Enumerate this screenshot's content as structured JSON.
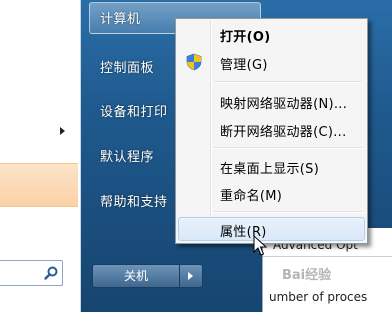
{
  "right_pane": {
    "computer": "计算机",
    "control_panel": "控制面板",
    "devices": "设备和打印",
    "default_programs": "默认程序",
    "help": "帮助和支持",
    "shutdown": "关机"
  },
  "context_menu": {
    "items": [
      {
        "label": "打开(O)"
      },
      {
        "label": "管理(G)"
      },
      {
        "label": "映射网络驱动器(N)..."
      },
      {
        "label": "断开网络驱动器(C)..."
      },
      {
        "label": "在桌面上显示(S)"
      },
      {
        "label": "重命名(M)"
      },
      {
        "label": "属性(R)"
      }
    ]
  },
  "background_window": {
    "title": "Advanced Opt",
    "text": "umber of proces"
  },
  "watermark": "Bai经验",
  "icons": {
    "search": "search-icon",
    "shield": "uac-shield-icon",
    "arrow": "chevron-right-icon",
    "cursor": "mouse-cursor-icon"
  },
  "colors": {
    "start_menu_blue": "#1f5a8e",
    "highlight_orange": "#fbd2a6",
    "menu_hover": "#d9e8f8"
  }
}
